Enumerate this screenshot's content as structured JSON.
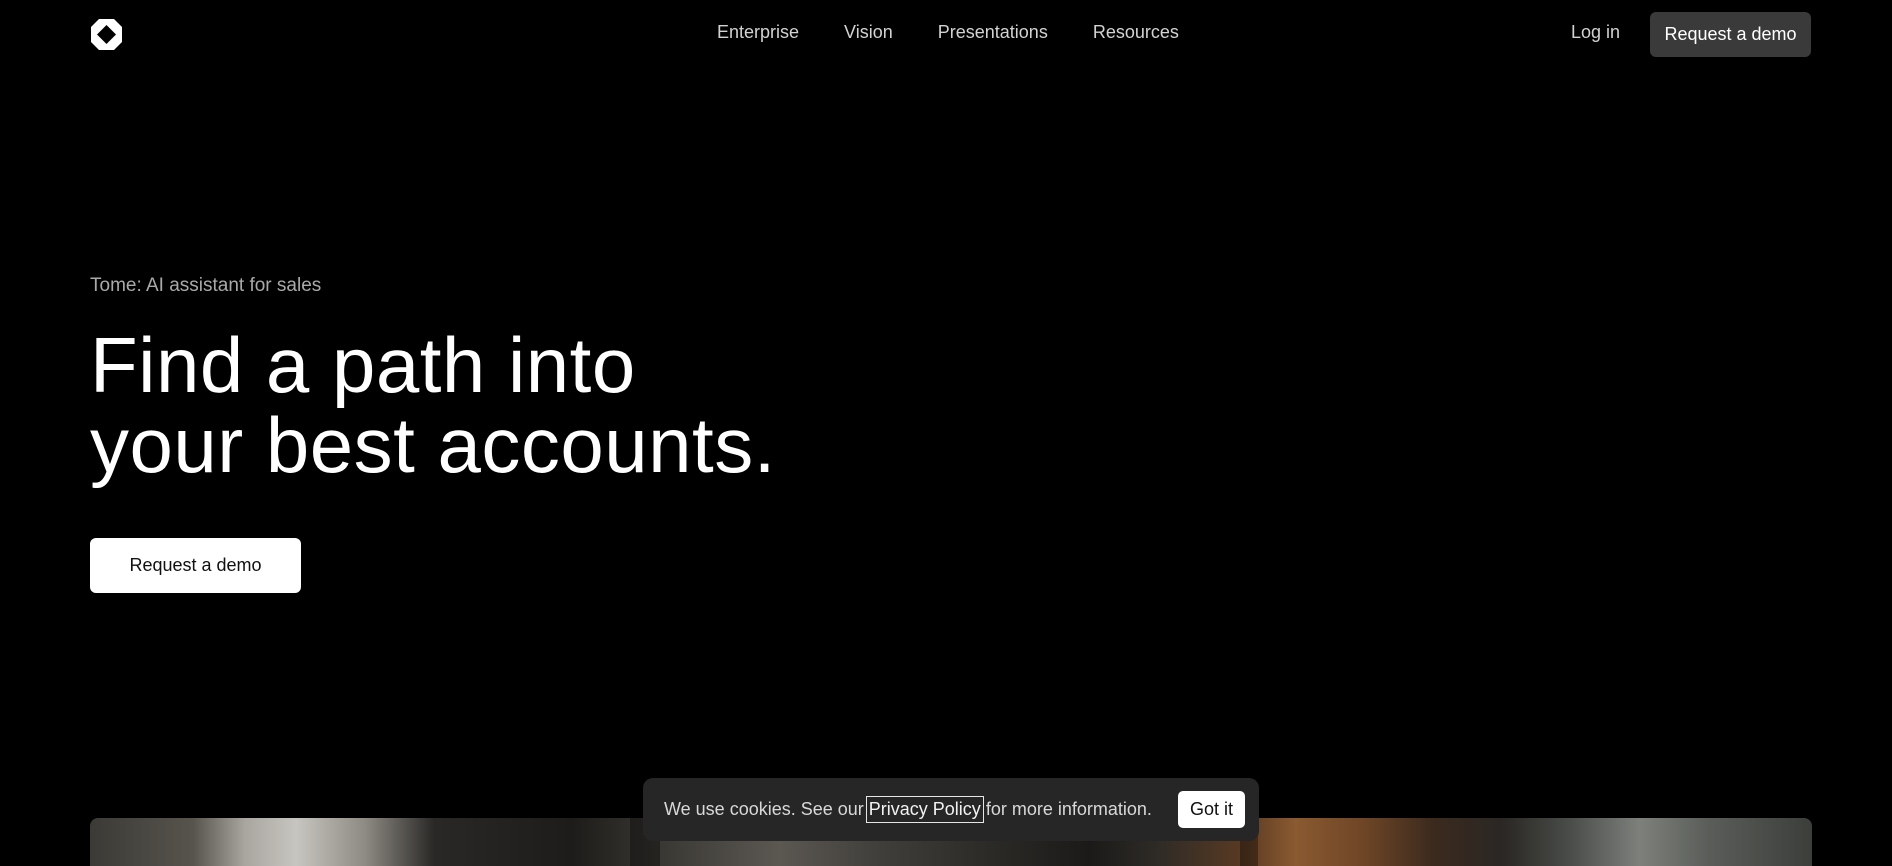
{
  "header": {
    "logo_icon": "tome-logo-icon",
    "nav": [
      {
        "label": "Enterprise"
      },
      {
        "label": "Vision"
      },
      {
        "label": "Presentations"
      },
      {
        "label": "Resources"
      }
    ],
    "login_label": "Log in",
    "cta_label": "Request a demo"
  },
  "hero": {
    "eyebrow": "Tome: AI assistant for sales",
    "headline_line1": "Find a path into",
    "headline_line2": "your best accounts.",
    "cta_label": "Request a demo"
  },
  "cookie_banner": {
    "text_before": "We use cookies. See our",
    "link_label": "Privacy Policy",
    "text_after": "for more information.",
    "button_label": "Got it"
  },
  "colors": {
    "background": "#000000",
    "header_cta_bg": "#3a3a3a",
    "hero_cta_bg": "#ffffff",
    "cookie_bg": "#262626"
  }
}
